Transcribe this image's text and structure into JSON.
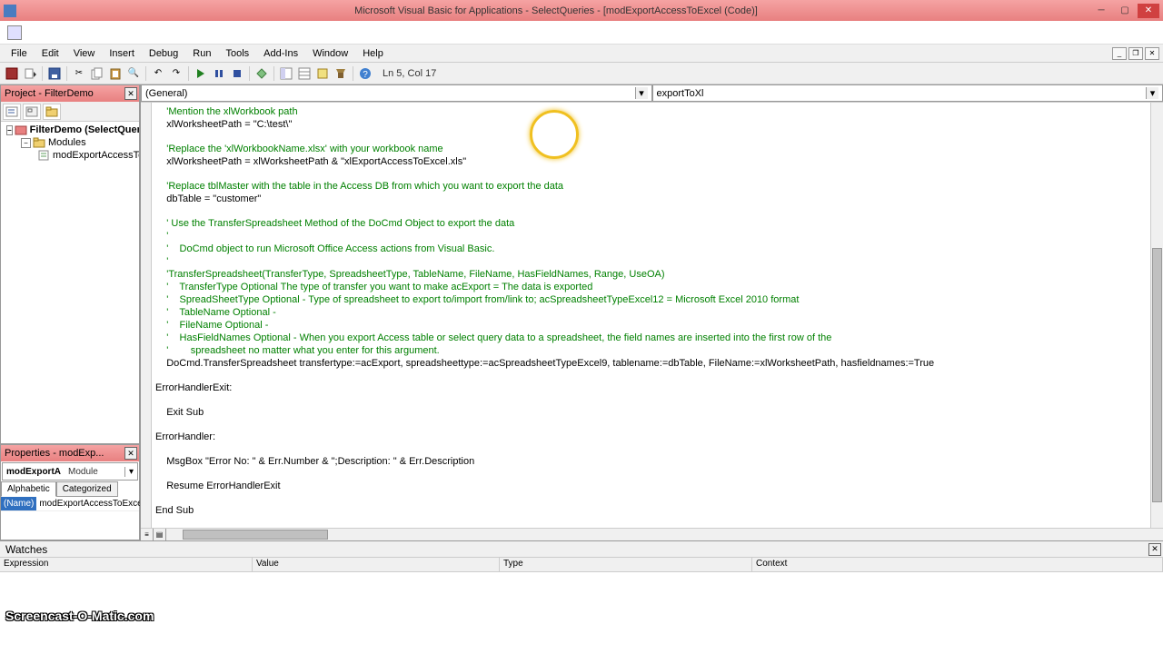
{
  "window": {
    "title": "Microsoft Visual Basic for Applications - SelectQueries - [modExportAccessToExcel (Code)]"
  },
  "menu": {
    "items": [
      "File",
      "Edit",
      "View",
      "Insert",
      "Debug",
      "Run",
      "Tools",
      "Add-Ins",
      "Window",
      "Help"
    ]
  },
  "toolbar": {
    "status": "Ln 5, Col 17"
  },
  "project": {
    "title": "Project - FilterDemo",
    "root": "FilterDemo (SelectQueri",
    "folder": "Modules",
    "module": "modExportAccessTo"
  },
  "properties": {
    "title": "Properties - modExp...",
    "obj_name": "modExportA",
    "obj_type": "Module",
    "tabs": {
      "alpha": "Alphabetic",
      "cat": "Categorized"
    },
    "row_key": "(Name)",
    "row_val": "modExportAccessToExce"
  },
  "combos": {
    "left": "(General)",
    "right": "exportToXl"
  },
  "code": {
    "l1": "    'Mention the xlWorkbook path",
    "l2": "    xlWorksheetPath = \"C:\\test\\\"",
    "l3": "",
    "l4": "    'Replace the 'xlWorkbookName.xlsx' with your workbook name",
    "l5": "    xlWorksheetPath = xlWorksheetPath & \"xlExportAccessToExcel.xls\"",
    "l6": "",
    "l7": "    'Replace tblMaster with the table in the Access DB from which you want to export the data",
    "l8": "    dbTable = \"customer\"",
    "l9": "",
    "l10": "    ' Use the TransferSpreadsheet Method of the DoCmd Object to export the data",
    "l11": "    '",
    "l12": "    '    DoCmd object to run Microsoft Office Access actions from Visual Basic.",
    "l13": "    '",
    "l14": "    'TransferSpreadsheet(TransferType, SpreadsheetType, TableName, FileName, HasFieldNames, Range, UseOA)",
    "l15": "    '    TransferType Optional The type of transfer you want to make acExport = The data is exported",
    "l16": "    '    SpreadSheetType Optional - Type of spreadsheet to export to/import from/link to; acSpreadsheetTypeExcel12 = Microsoft Excel 2010 format",
    "l17": "    '    TableName Optional -",
    "l18": "    '    FileName Optional -",
    "l19": "    '    HasFieldNames Optional - When you export Access table or select query data to a spreadsheet, the field names are inserted into the first row of the",
    "l20": "    '        spreadsheet no matter what you enter for this argument.",
    "l21": "    DoCmd.TransferSpreadsheet transfertype:=acExport, spreadsheettype:=acSpreadsheetTypeExcel9, tablename:=dbTable, FileName:=xlWorksheetPath, hasfieldnames:=True",
    "l22": "",
    "l23": "ErrorHandlerExit:",
    "l24": "",
    "l25": "    Exit Sub",
    "l26": "",
    "l27": "ErrorHandler:",
    "l28": "",
    "l29": "    MsgBox \"Error No: \" & Err.Number & \";Description: \" & Err.Description",
    "l30": "",
    "l31": "    Resume ErrorHandlerExit",
    "l32": "",
    "l33": "End Sub"
  },
  "watches": {
    "title": "Watches",
    "cols": {
      "expr": "Expression",
      "val": "Value",
      "type": "Type",
      "ctx": "Context"
    }
  },
  "watermark": "Screencast-O-Matic.com"
}
